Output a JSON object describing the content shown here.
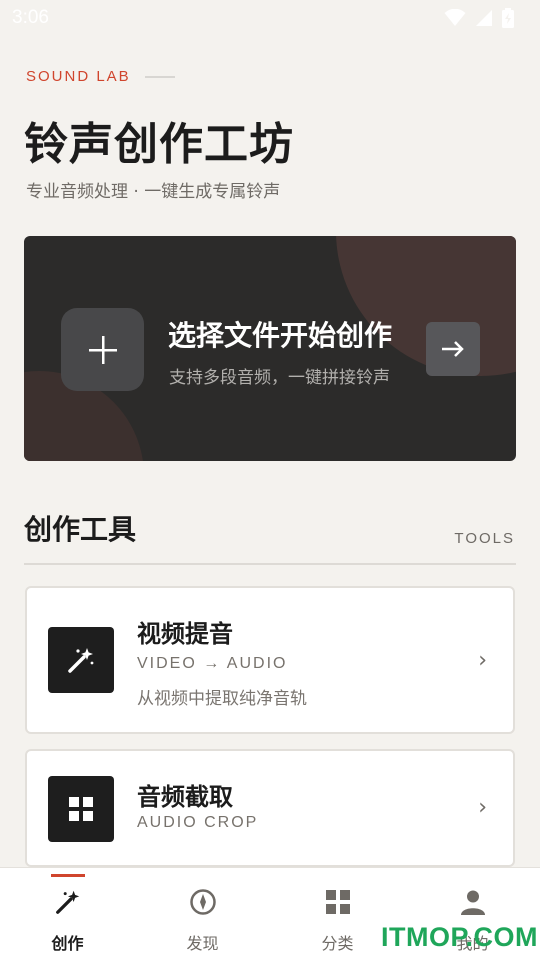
{
  "status_bar": {
    "time": "3:06"
  },
  "header": {
    "eyebrow": "SOUND LAB",
    "title": "铃声创作工坊",
    "subtitle": "专业音频处理 · 一键生成专属铃声"
  },
  "hero": {
    "title": "选择文件开始创作",
    "subtitle": "支持多段音频，一键拼接铃声"
  },
  "section": {
    "title": "创作工具",
    "tag": "TOOLS"
  },
  "tools": [
    {
      "name": "视频提音",
      "en": "VIDEO → AUDIO",
      "desc": "从视频中提取纯净音轨",
      "icon": "magic-wand-icon"
    },
    {
      "name": "音频截取",
      "en": "AUDIO CROP",
      "desc": "",
      "icon": "grid-icon"
    }
  ],
  "nav": {
    "items": [
      {
        "label": "创作",
        "icon": "magic-wand-icon",
        "active": true
      },
      {
        "label": "发现",
        "icon": "compass-icon",
        "active": false
      },
      {
        "label": "分类",
        "icon": "grid-icon",
        "active": false
      },
      {
        "label": "我的",
        "icon": "person-icon",
        "active": false
      }
    ]
  },
  "watermark": "ITMOP.COM",
  "colors": {
    "accent": "#d0452d",
    "background": "#f4f2ee",
    "hero": "#2c2b2a",
    "watermark": "#1fa65a"
  }
}
